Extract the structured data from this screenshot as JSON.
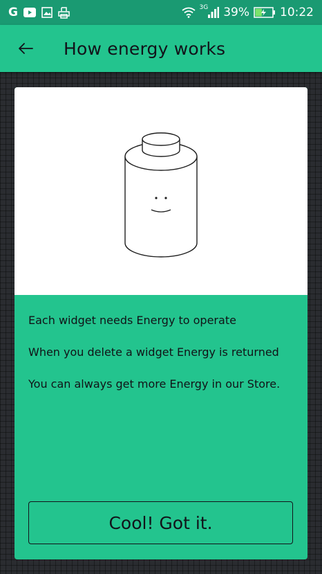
{
  "status_bar": {
    "left_icons": [
      "google-icon",
      "youtube-icon",
      "gallery-icon",
      "printer-icon"
    ],
    "google_glyph": "G",
    "network_type": "3G",
    "battery_percent": "39%",
    "battery_level": 0.39,
    "time": "10:22"
  },
  "header": {
    "back_icon": "arrow-back-icon",
    "title": "How energy works"
  },
  "card": {
    "illustration": "battery-face-illustration",
    "lines": [
      "Each widget needs Energy to operate",
      "When you delete a widget Energy is returned",
      "You can always get more Energy in our Store."
    ],
    "button_label": "Cool! Got it."
  },
  "colors": {
    "accent": "#23c48e",
    "status_bar": "#1a9a72",
    "background": "#2a2c30",
    "text_dark": "#12131a"
  }
}
